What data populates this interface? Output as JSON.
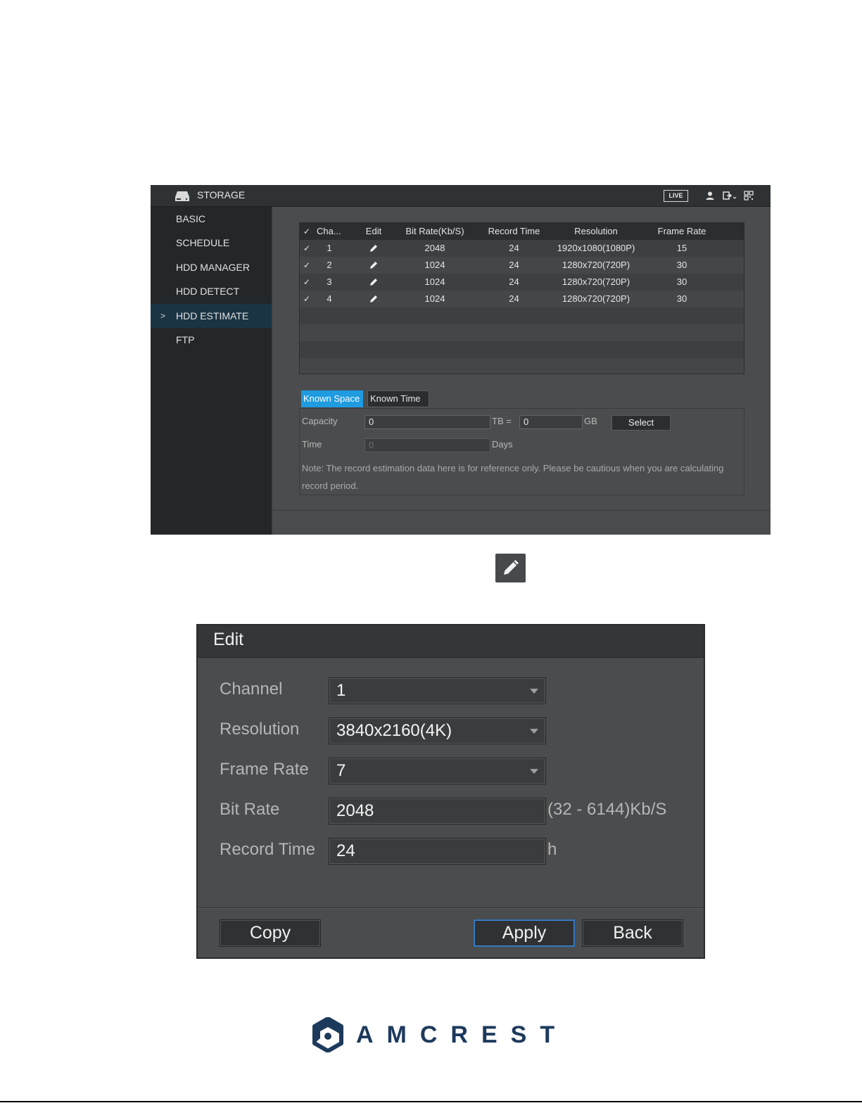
{
  "storage": {
    "title": "STORAGE",
    "live_label": "LIVE",
    "sidebar": [
      {
        "label": "BASIC",
        "active": false
      },
      {
        "label": "SCHEDULE",
        "active": false
      },
      {
        "label": "HDD MANAGER",
        "active": false
      },
      {
        "label": "HDD DETECT",
        "active": false
      },
      {
        "label": "HDD ESTIMATE",
        "active": true
      },
      {
        "label": "FTP",
        "active": false
      }
    ],
    "active_marker": ">",
    "table": {
      "headers": {
        "check": "✓",
        "channel": "Cha...",
        "edit": "Edit",
        "bitrate": "Bit Rate(Kb/S)",
        "record_time": "Record Time",
        "resolution": "Resolution",
        "frame_rate": "Frame Rate"
      },
      "rows": [
        {
          "check": "✓",
          "channel": "1",
          "bitrate": "2048",
          "record_time": "24",
          "resolution": "1920x1080(1080P)",
          "frame_rate": "15"
        },
        {
          "check": "✓",
          "channel": "2",
          "bitrate": "1024",
          "record_time": "24",
          "resolution": "1280x720(720P)",
          "frame_rate": "30"
        },
        {
          "check": "✓",
          "channel": "3",
          "bitrate": "1024",
          "record_time": "24",
          "resolution": "1280x720(720P)",
          "frame_rate": "30"
        },
        {
          "check": "✓",
          "channel": "4",
          "bitrate": "1024",
          "record_time": "24",
          "resolution": "1280x720(720P)",
          "frame_rate": "30"
        }
      ]
    },
    "tabs": {
      "known_space": "Known Space",
      "known_time": "Known Time"
    },
    "calc": {
      "capacity_label": "Capacity",
      "capacity_tb": "0",
      "tb_unit": "TB =",
      "capacity_gb": "0",
      "gb_unit": "GB",
      "select_label": "Select",
      "time_label": "Time",
      "time_value": "0",
      "days_unit": "Days",
      "note": "Note: The record estimation data here is for reference only. Please be cautious when you are calculating record period."
    }
  },
  "edit_dialog": {
    "title": "Edit",
    "fields": {
      "channel_label": "Channel",
      "channel_value": "1",
      "resolution_label": "Resolution",
      "resolution_value": "3840x2160(4K)",
      "frame_rate_label": "Frame Rate",
      "frame_rate_value": "7",
      "bit_rate_label": "Bit Rate",
      "bit_rate_value": "2048",
      "bit_rate_range": "(32 - 6144)Kb/S",
      "record_time_label": "Record Time",
      "record_time_value": "24",
      "record_time_unit": "h"
    },
    "buttons": {
      "copy": "Copy",
      "apply": "Apply",
      "back": "Back"
    }
  },
  "logo": {
    "brand": "AMCREST"
  },
  "icons": [
    "hdd-icon",
    "user-icon",
    "logout-icon",
    "qr-icon",
    "pencil-icon",
    "amcrest-logo-icon"
  ],
  "colors": {
    "accent": "#1f9be0",
    "brand": "#1d3a5c",
    "sidebar_active": "#1a3444"
  }
}
